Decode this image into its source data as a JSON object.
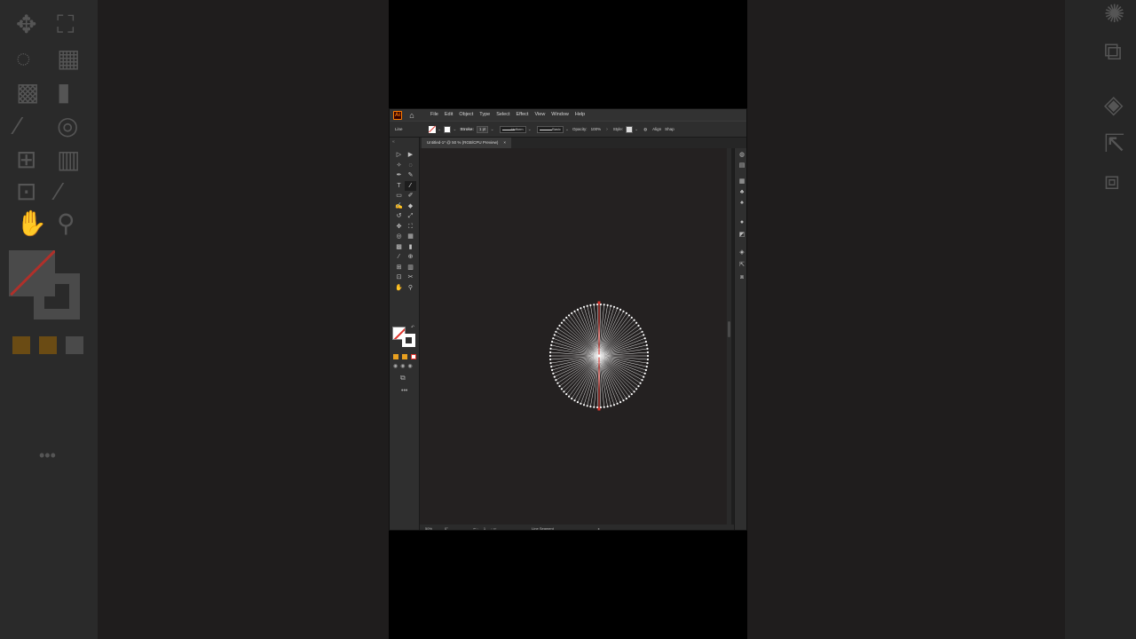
{
  "app": {
    "logo_text": "Ai",
    "menu": [
      "File",
      "Edit",
      "Object",
      "Type",
      "Select",
      "Effect",
      "View",
      "Window",
      "Help"
    ]
  },
  "control_bar": {
    "selection_label": "Line",
    "stroke_label": "Stroke:",
    "stroke_weight": "1 pt",
    "profile_label": "Uniform",
    "brush_label": "Basic",
    "opacity_label": "Opacity:",
    "opacity_value": "100%",
    "style_label": "Style:",
    "align_label": "Align",
    "shape_label": "Shap"
  },
  "document_tab": {
    "title": "Untitled-1* @ 50 % (RGB/CPU Preview)",
    "close": "×"
  },
  "status_bar": {
    "zoom": "50%",
    "rotation": "0°",
    "artboard": "1",
    "tool_name": "Line Segment"
  },
  "toolbar": {
    "more": "•••"
  },
  "colors": {
    "accent": "#ff7c00",
    "stroke_red": "#e0332b",
    "canvas": "#242121",
    "swatch_orange": "#e8a020"
  }
}
